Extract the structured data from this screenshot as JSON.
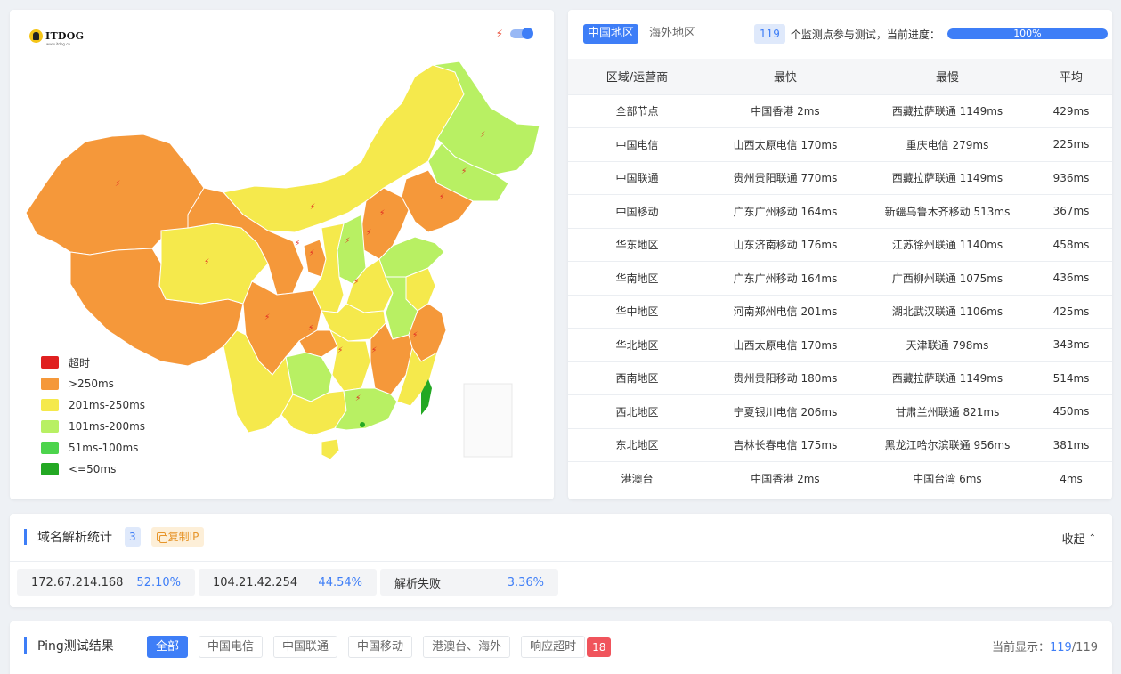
{
  "logo": {
    "text": "ITDOG",
    "sub": "www.itdog.cn"
  },
  "map": {
    "legend": [
      {
        "label": "超时",
        "color": "#e02020"
      },
      {
        "label": ">250ms",
        "color": "#f5983a"
      },
      {
        "label": "201ms-250ms",
        "color": "#f5e94c"
      },
      {
        "label": "101ms-200ms",
        "color": "#b8f063"
      },
      {
        "label": "51ms-100ms",
        "color": "#4cd44c"
      },
      {
        "label": "<=50ms",
        "color": "#23a823"
      }
    ]
  },
  "stats": {
    "tabs": [
      {
        "label": "中国地区",
        "active": true
      },
      {
        "label": "海外地区",
        "active": false
      }
    ],
    "probe_count": "119",
    "probe_text": "个监测点参与测试，当前进度：",
    "progress": {
      "percent": 100,
      "label": "100%"
    },
    "columns": [
      "区域/运营商",
      "最快",
      "最慢",
      "平均"
    ],
    "rows": [
      [
        "全部节点",
        "中国香港 2ms",
        "西藏拉萨联通 1149ms",
        "429ms"
      ],
      [
        "中国电信",
        "山西太原电信 170ms",
        "重庆电信 279ms",
        "225ms"
      ],
      [
        "中国联通",
        "贵州贵阳联通 770ms",
        "西藏拉萨联通 1149ms",
        "936ms"
      ],
      [
        "中国移动",
        "广东广州移动 164ms",
        "新疆乌鲁木齐移动 513ms",
        "367ms"
      ],
      [
        "华东地区",
        "山东济南移动 176ms",
        "江苏徐州联通 1140ms",
        "458ms"
      ],
      [
        "华南地区",
        "广东广州移动 164ms",
        "广西柳州联通 1075ms",
        "436ms"
      ],
      [
        "华中地区",
        "河南郑州电信 201ms",
        "湖北武汉联通 1106ms",
        "425ms"
      ],
      [
        "华北地区",
        "山西太原电信 170ms",
        "天津联通 798ms",
        "343ms"
      ],
      [
        "西南地区",
        "贵州贵阳移动 180ms",
        "西藏拉萨联通 1149ms",
        "514ms"
      ],
      [
        "西北地区",
        "宁夏银川电信 206ms",
        "甘肃兰州联通 821ms",
        "450ms"
      ],
      [
        "东北地区",
        "吉林长春电信 175ms",
        "黑龙江哈尔滨联通 956ms",
        "381ms"
      ],
      [
        "港澳台",
        "中国香港 2ms",
        "中国台湾 6ms",
        "4ms"
      ]
    ]
  },
  "dns": {
    "title": "域名解析统计",
    "count": "3",
    "copy_label": "复制IP",
    "collapse_label": "收起",
    "items": [
      {
        "ip": "172.67.214.168",
        "pct": "52.10%"
      },
      {
        "ip": "104.21.42.254",
        "pct": "44.54%"
      },
      {
        "ip": "解析失败",
        "pct": "3.36%"
      }
    ]
  },
  "ping": {
    "title": "Ping测试结果",
    "filters": [
      {
        "label": "全部",
        "active": true
      },
      {
        "label": "中国电信",
        "active": false
      },
      {
        "label": "中国联通",
        "active": false
      },
      {
        "label": "中国移动",
        "active": false
      },
      {
        "label": "港澳台、海外",
        "active": false
      },
      {
        "label": "响应超时",
        "active": false
      }
    ],
    "timeout_count": "18",
    "display_prefix": "当前显示：",
    "display_current": "119",
    "display_total": "/119"
  }
}
